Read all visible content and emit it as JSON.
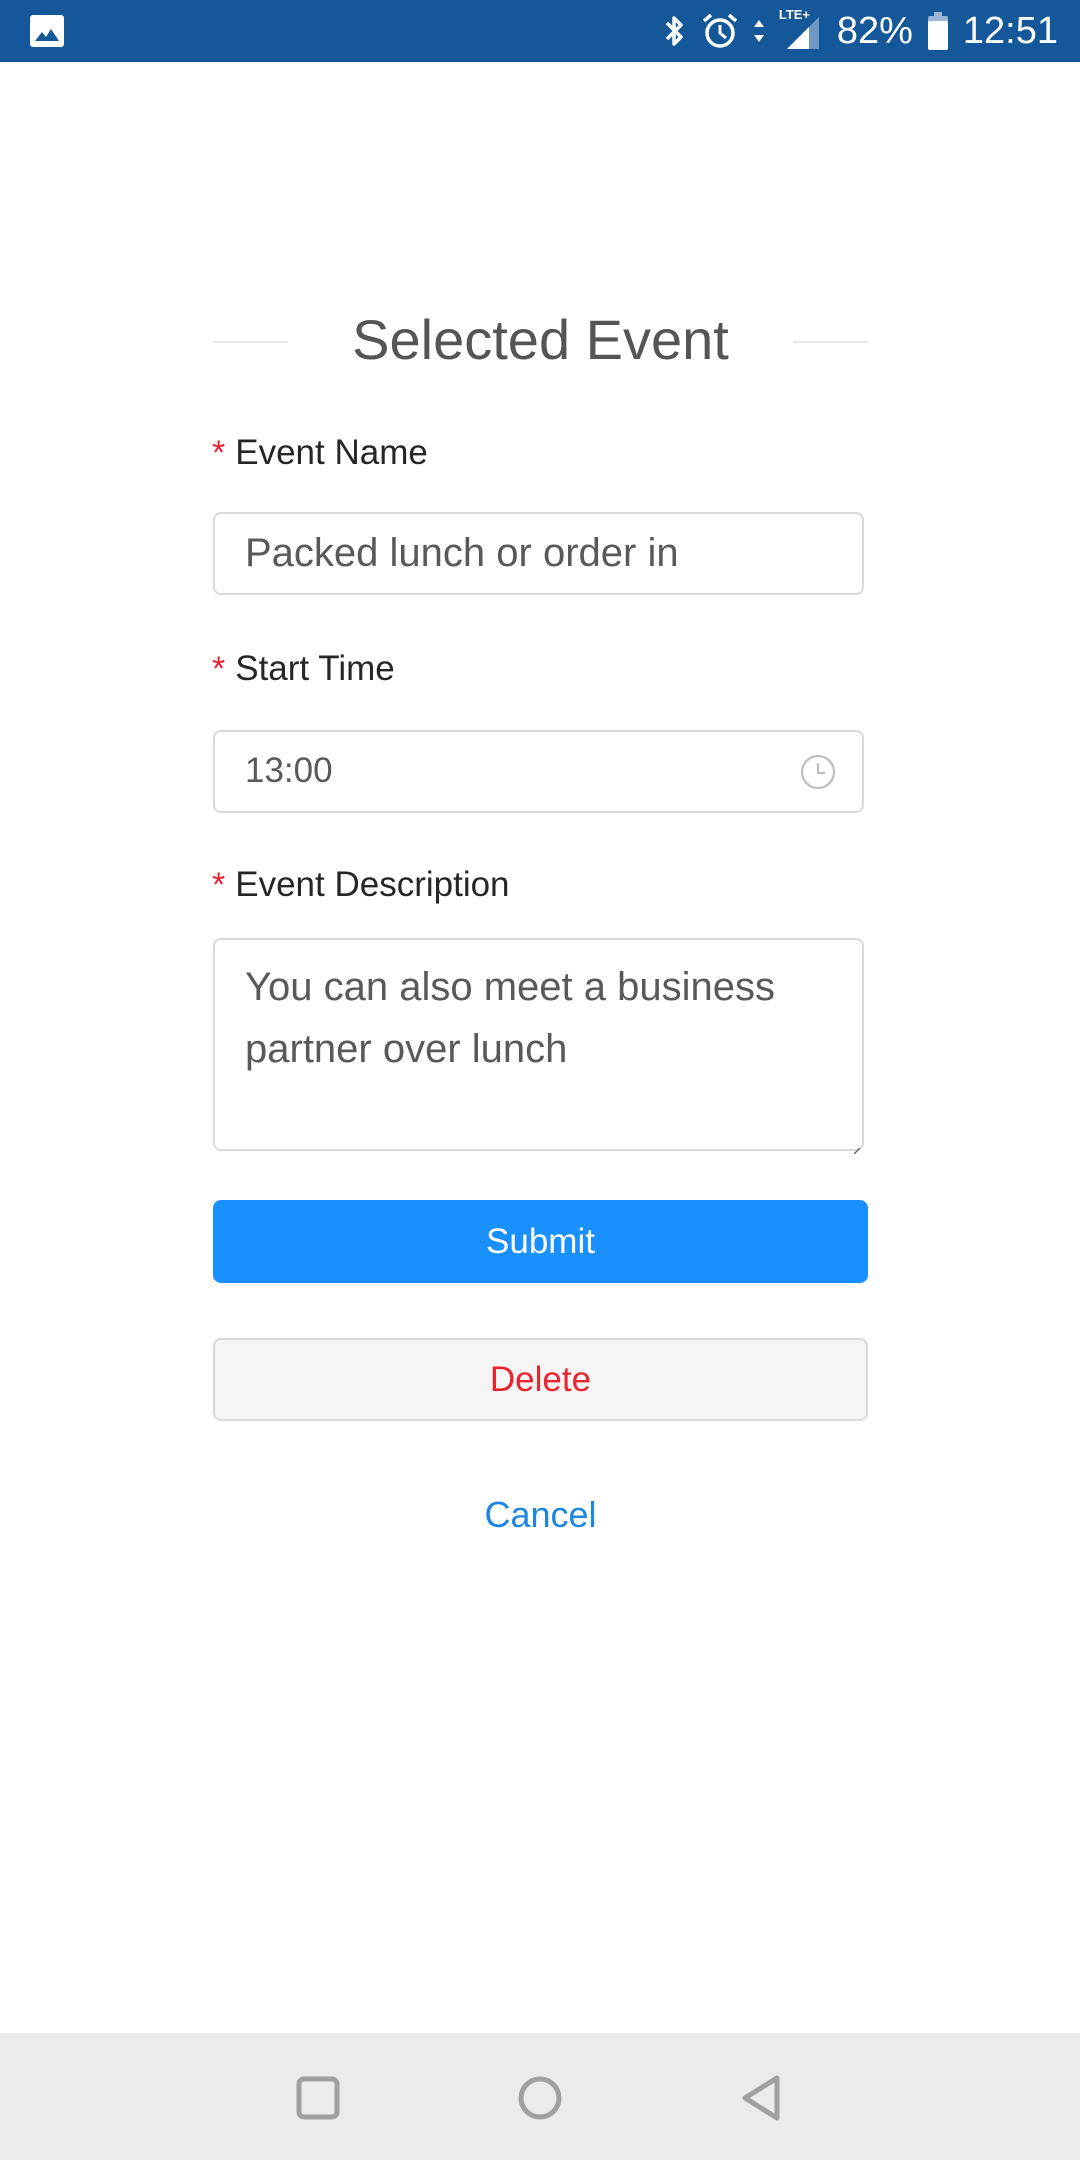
{
  "status_bar": {
    "left_icons": [
      "gallery-icon"
    ],
    "right_icons": [
      "bluetooth-icon",
      "alarm-icon",
      "data-arrows-icon",
      "signal-lte-icon",
      "battery-icon"
    ],
    "network_label": "LTE+",
    "battery_percent": "82%",
    "time": "12:51",
    "colors": {
      "background": "#14589a",
      "foreground": "#ffffff"
    }
  },
  "form": {
    "title": "Selected Event",
    "required_marker": "*",
    "fields": [
      {
        "label": "Event Name",
        "type": "text",
        "value": "Packed lunch or order in",
        "required": true
      },
      {
        "label": "Start Time",
        "type": "time",
        "value": "13:00",
        "required": true,
        "icon": "clock-icon"
      },
      {
        "label": "Event Description",
        "type": "textarea",
        "value": "You can also meet a business partner over lunch",
        "required": true
      }
    ],
    "buttons": {
      "submit": "Submit",
      "delete": "Delete",
      "cancel": "Cancel"
    },
    "colors": {
      "primary": "#1890ff",
      "danger": "#e8242f",
      "link": "#1c86e0",
      "border": "#d9d9d9"
    }
  },
  "nav_bar": {
    "buttons": [
      "recents-icon",
      "home-icon",
      "back-icon"
    ]
  }
}
